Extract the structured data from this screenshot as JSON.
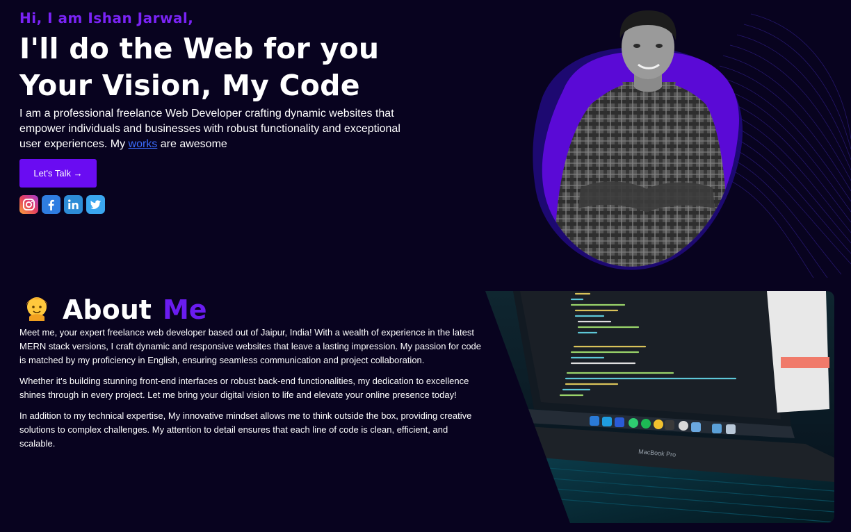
{
  "hero": {
    "greeting": "Hi, I am Ishan Jarwal,",
    "headline_line1": "I'll do the Web for you",
    "headline_line2": "Your Vision, My Code",
    "intro_before": "I am a professional freelance Web Developer crafting dynamic websites that empower individuals and businesses with robust functionality and exceptional user experiences. My ",
    "intro_link": "works",
    "intro_after": " are awesome",
    "cta_label": "Let's Talk →",
    "socials": [
      {
        "name": "instagram-icon",
        "glyph": "◎"
      },
      {
        "name": "facebook-icon",
        "glyph": "f"
      },
      {
        "name": "linkedin-icon",
        "glyph": "in"
      },
      {
        "name": "twitter-icon",
        "glyph": "✦"
      }
    ]
  },
  "about": {
    "title_white": "About",
    "title_accent": "Me",
    "emoji_icon": "person-emoji-icon",
    "paragraphs": [
      "Meet me, your expert freelance web developer based out of Jaipur, India! With a wealth of experience in the latest MERN stack versions, I craft dynamic and responsive websites that leave a lasting impression. My passion for code is matched by my proficiency in English, ensuring seamless communication and project collaboration.",
      "Whether it's building stunning front-end interfaces or robust back-end functionalities, my dedication to excellence shines through in every project. Let me bring your digital vision to life and elevate your online presence today!",
      "In addition to my technical expertise, My innovative mindset allows me to think outside the box, providing creative solutions to complex challenges. My attention to detail ensures that each line of code is clean, efficient, and scalable."
    ]
  },
  "laptop": {
    "brand": "MacBook Pro"
  },
  "colors": {
    "background": "#08031f",
    "accent": "#6a0cf2",
    "link": "#3b6dff"
  }
}
